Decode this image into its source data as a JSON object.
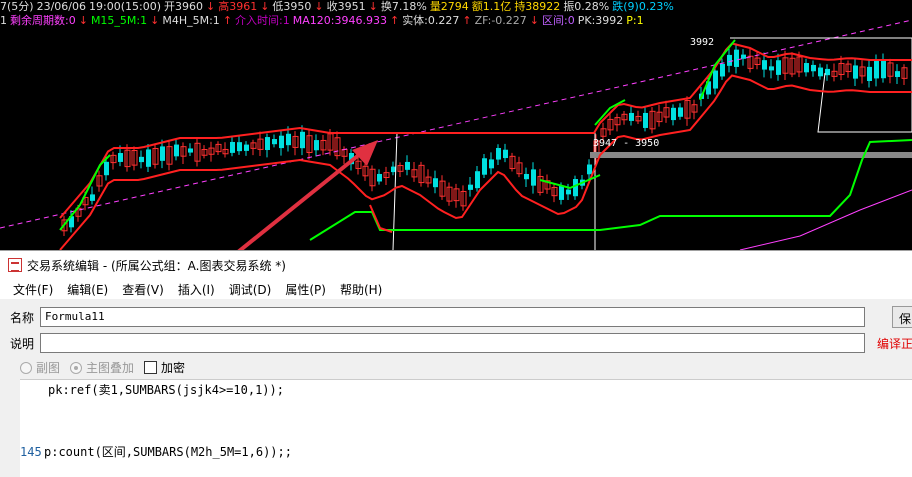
{
  "info_bar": {
    "segments": [
      {
        "text": "7(5分)",
        "color": "#dddddd"
      },
      {
        "text": "23/06/06",
        "color": "#dddddd"
      },
      {
        "text": "19:00(15:00)",
        "color": "#dddddd"
      },
      {
        "text": "开3960",
        "color": "#dddddd"
      },
      {
        "text": "↓",
        "color": "#ff3030"
      },
      {
        "text": "高3961",
        "color": "#ff3030"
      },
      {
        "text": "↓",
        "color": "#ff3030"
      },
      {
        "text": "低3950",
        "color": "#dddddd"
      },
      {
        "text": "↓",
        "color": "#ff3030"
      },
      {
        "text": "收3951",
        "color": "#dddddd"
      },
      {
        "text": "↓",
        "color": "#ff3030"
      },
      {
        "text": "换7.18%",
        "color": "#dddddd"
      },
      {
        "text": "量2794",
        "color": "#ffd700"
      },
      {
        "text": "额1.1亿",
        "color": "#ffd700"
      },
      {
        "text": "持38922",
        "color": "#ffd700"
      },
      {
        "text": "振0.28%",
        "color": "#dddddd"
      },
      {
        "text": "跌(9)0.23%",
        "color": "#00d0ff"
      }
    ]
  },
  "info_bar2": {
    "segments": [
      {
        "text": "1",
        "color": "#dddddd"
      },
      {
        "text": "剩余周期数:0",
        "color": "#ff40ff"
      },
      {
        "text": "↓",
        "color": "#ff3030"
      },
      {
        "text": "M15_5M:1",
        "color": "#00ff00"
      },
      {
        "text": "↓",
        "color": "#ff3030"
      },
      {
        "text": "M4H_5M:1",
        "color": "#dddddd"
      },
      {
        "text": "↑",
        "color": "#ff3030"
      },
      {
        "text": "介入时间:1",
        "color": "#c000c0"
      },
      {
        "text": "MA120:3946.933",
        "color": "#ff40ff"
      },
      {
        "text": "↑",
        "color": "#ff3030"
      },
      {
        "text": "实体:0.227",
        "color": "#dddddd"
      },
      {
        "text": "↑",
        "color": "#ff3030"
      },
      {
        "text": "ZF:-0.227",
        "color": "#aaaaaa"
      },
      {
        "text": "↓",
        "color": "#ff3030"
      },
      {
        "text": "区间:0",
        "color": "#c060ff"
      },
      {
        "text": "PK:3992",
        "color": "#dddddd"
      },
      {
        "text": "P:1",
        "color": "#ffff00"
      }
    ]
  },
  "chart_labels": {
    "high_label": "3992",
    "range_label": "3947 - 3950"
  },
  "colors": {
    "up_candle": "#ff3030",
    "down_candle": "#00e0e0",
    "upper_band": "#ff2020",
    "green_band": "#00ff00",
    "ma_line": "#ff40ff",
    "arrow": "#e03040"
  },
  "editor": {
    "title": "交易系统编辑 - (所属公式组：A.图表交易系统 *)",
    "menu": [
      "文件(F)",
      "编辑(E)",
      "查看(V)",
      "插入(I)",
      "调试(D)",
      "属性(P)",
      "帮助(H)"
    ],
    "name_label": "名称",
    "name_value": "Formula11",
    "desc_label": "说明",
    "desc_value": "",
    "save_button": "保",
    "compile_status": "编译正",
    "options": {
      "sub_chart": "副图",
      "main_overlay": "主图叠加",
      "add_password": "加密"
    },
    "code": {
      "line1": "pk:ref(卖1,SUMBARS(jsjk4>=10,1));",
      "line2_no": "145",
      "line2": "p:count(区间,SUMBARS(M2h_5M=1,6));;"
    }
  }
}
